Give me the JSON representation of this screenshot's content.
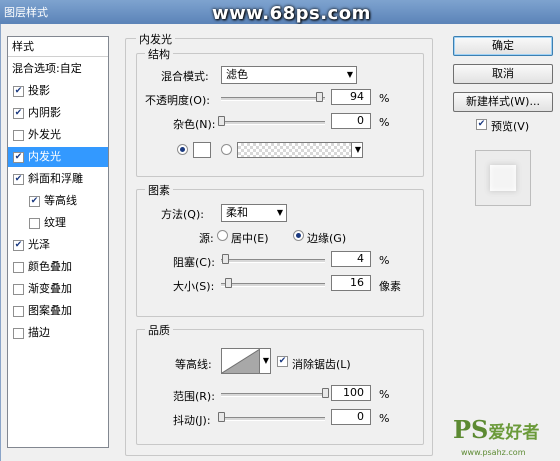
{
  "window": {
    "title": "图层样式",
    "watermark": "www.68ps.com"
  },
  "style_list": {
    "header": "样式",
    "items": [
      {
        "label": "混合选项:自定",
        "checkbox": false,
        "checked": false,
        "selected": false,
        "indent": 0
      },
      {
        "label": "投影",
        "checkbox": true,
        "checked": true,
        "selected": false,
        "indent": 0
      },
      {
        "label": "内阴影",
        "checkbox": true,
        "checked": true,
        "selected": false,
        "indent": 0
      },
      {
        "label": "外发光",
        "checkbox": true,
        "checked": false,
        "selected": false,
        "indent": 0
      },
      {
        "label": "内发光",
        "checkbox": true,
        "checked": true,
        "selected": true,
        "indent": 0
      },
      {
        "label": "斜面和浮雕",
        "checkbox": true,
        "checked": true,
        "selected": false,
        "indent": 0
      },
      {
        "label": "等高线",
        "checkbox": true,
        "checked": true,
        "selected": false,
        "indent": 1
      },
      {
        "label": "纹理",
        "checkbox": true,
        "checked": false,
        "selected": false,
        "indent": 1
      },
      {
        "label": "光泽",
        "checkbox": true,
        "checked": true,
        "selected": false,
        "indent": 0
      },
      {
        "label": "颜色叠加",
        "checkbox": true,
        "checked": false,
        "selected": false,
        "indent": 0
      },
      {
        "label": "渐变叠加",
        "checkbox": true,
        "checked": false,
        "selected": false,
        "indent": 0
      },
      {
        "label": "图案叠加",
        "checkbox": true,
        "checked": false,
        "selected": false,
        "indent": 0
      },
      {
        "label": "描边",
        "checkbox": true,
        "checked": false,
        "selected": false,
        "indent": 0
      }
    ]
  },
  "inner_glow": {
    "title": "内发光",
    "structure": {
      "title": "结构",
      "blend_mode_label": "混合模式:",
      "blend_mode_value": "滤色",
      "opacity_label": "不透明度(O):",
      "opacity_value": "94",
      "opacity_level": 0.94,
      "noise_label": "杂色(N):",
      "noise_value": "0",
      "noise_level": 0,
      "unit": "%"
    },
    "elements": {
      "title": "图素",
      "method_label": "方法(Q):",
      "method_value": "柔和",
      "source_label": "源:",
      "source_center": "居中(E)",
      "source_edge": "边缘(G)",
      "choke_label": "阻塞(C):",
      "choke_value": "4",
      "choke_level": 0.04,
      "choke_unit": "%",
      "size_label": "大小(S):",
      "size_value": "16",
      "size_level": 0.064,
      "size_unit": "像素"
    },
    "quality": {
      "title": "品质",
      "contour_label": "等高线:",
      "antialias_label": "消除锯齿(L)",
      "range_label": "范围(R):",
      "range_value": "100",
      "range_level": 1.0,
      "jitter_label": "抖动(J):",
      "jitter_value": "0",
      "jitter_level": 0,
      "unit": "%"
    }
  },
  "buttons": {
    "ok": "确定",
    "cancel": "取消",
    "new_style": "新建样式(W)...",
    "preview": "预览(V)"
  },
  "logo": {
    "text": "PS",
    "han": "爱好者",
    "url": "www.psahz.com"
  }
}
